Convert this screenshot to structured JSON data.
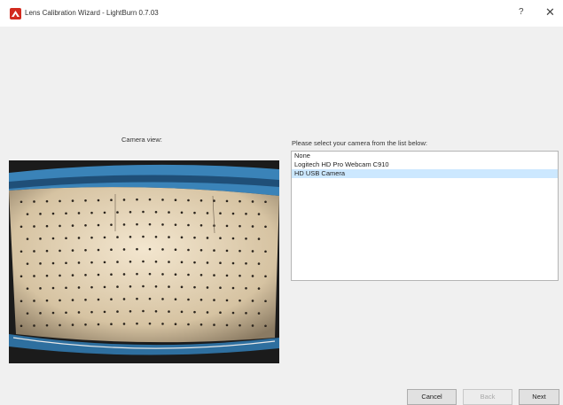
{
  "window": {
    "title": "Lens Calibration Wizard - LightBurn 0.7.03",
    "help_label": "?",
    "close_label": "✕",
    "icon": "lightburn-app-icon"
  },
  "camera_panel": {
    "label": "Camera view:"
  },
  "camera_select": {
    "label": "Please select your camera from the list below:",
    "items": [
      "None",
      "Logitech HD Pro Webcam C910",
      "HD USB Camera"
    ],
    "selected": "HD USB Camera",
    "selected_color": "#cce8ff"
  },
  "buttons": {
    "cancel": "Cancel",
    "back": "Back",
    "next": "Next"
  }
}
